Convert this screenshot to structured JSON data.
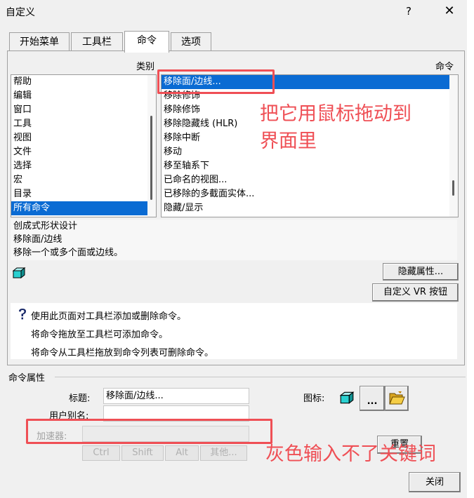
{
  "window": {
    "title": "自定义",
    "help": "?",
    "close": "✕"
  },
  "tabs": [
    {
      "label": "开始菜单"
    },
    {
      "label": "工具栏"
    },
    {
      "label": "命令"
    },
    {
      "label": "选项"
    }
  ],
  "categories_header": "类别",
  "commands_header": "命令",
  "categories": [
    "帮助",
    "编辑",
    "窗口",
    "工具",
    "视图",
    "文件",
    "选择",
    "宏",
    "目录",
    "所有命令"
  ],
  "categories_selected_index": 9,
  "commands": [
    "移除面/边线...",
    "移除修饰",
    "移除修饰",
    "移除隐藏线 (HLR)",
    "移除中断",
    "移动",
    "移至轴系下",
    "已命名的视图...",
    "已移除的多截面实体...",
    "隐藏/显示"
  ],
  "commands_selected_index": 0,
  "description": [
    "创成式形状设计",
    "移除面/边线",
    "移除一个或多个面或边线。"
  ],
  "buttons": {
    "hide_properties": "隐藏属性...",
    "customize_vr": "自定义 VR 按钮"
  },
  "info": {
    "line1": "使用此页面对工具栏添加或删除命令。",
    "line2": "将命令拖放至工具栏可添加命令。",
    "line3": "将命令从工具栏拖放到命令列表可删除命令。"
  },
  "properties": {
    "section_title": "命令属性",
    "title_label": "标题:",
    "title_value": "移除面/边线...",
    "alias_label": "用户别名:",
    "alias_value": "",
    "icon_label": "图标:",
    "more_button": "...",
    "accelerator_label": "加速器:",
    "accelerator_value": "",
    "ctrl": "Ctrl",
    "shift": "Shift",
    "alt": "Alt",
    "other": "其他...",
    "reset": "重置",
    "close": "关闭"
  },
  "annotations": {
    "note1_line1": "把它用鼠标拖动到",
    "note1_line2": "界面里",
    "note2": "灰色输入不了关键词"
  },
  "colors": {
    "selection": "#0a6bd3",
    "annotation": "#ef4f55"
  }
}
